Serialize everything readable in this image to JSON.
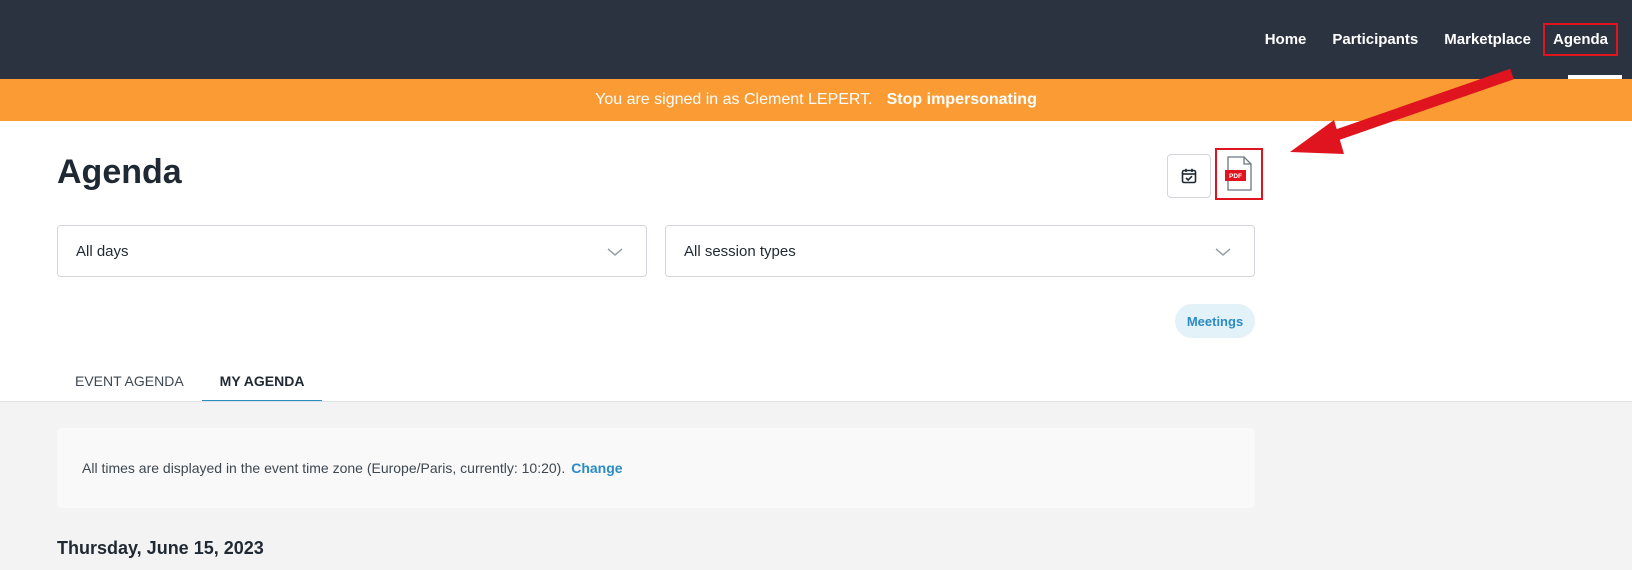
{
  "nav": {
    "items": [
      {
        "label": "Home"
      },
      {
        "label": "Participants"
      },
      {
        "label": "Marketplace"
      },
      {
        "label": "Agenda"
      }
    ]
  },
  "impersonation": {
    "message": "You are signed in as Clement LEPERT.",
    "stop_label": "Stop impersonating"
  },
  "page": {
    "title": "Agenda",
    "calendar_icon": "calendar-check-icon",
    "pdf_icon": "pdf-file-icon",
    "pdf_badge": "PDF"
  },
  "filters": {
    "days": {
      "value": "All days"
    },
    "types": {
      "value": "All session types"
    }
  },
  "chip": {
    "label": "Meetings"
  },
  "tabs": [
    {
      "label": "EVENT AGENDA"
    },
    {
      "label": "MY AGENDA"
    }
  ],
  "timezone": {
    "text": "All times are displayed in the event time zone (Europe/Paris, currently: 10:20).",
    "change_label": "Change"
  },
  "day_heading": "Thursday, June 15, 2023",
  "colors": {
    "nav_bg": "#2c3340",
    "impersonation_bg": "#fb9b34",
    "accent": "#2a8cc4",
    "highlight": "#e0141e"
  }
}
